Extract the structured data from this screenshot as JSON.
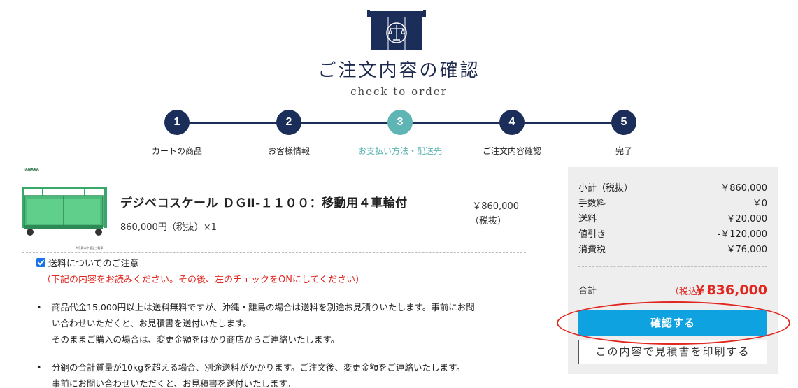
{
  "header": {
    "title": "ご注文内容の確認",
    "subtitle": "check to order"
  },
  "steps": [
    {
      "num": "1",
      "label": "カートの商品"
    },
    {
      "num": "2",
      "label": "お客様情報"
    },
    {
      "num": "3",
      "label": "お支払い方法・配送先"
    },
    {
      "num": "4",
      "label": "ご注文内容確認"
    },
    {
      "num": "5",
      "label": "完了"
    }
  ],
  "active_step": 3,
  "product": {
    "brand": "TANAKA",
    "name": "デジベコスケール ＤＧⅡ-１１００：移動用４車輪付",
    "unit_line": "860,000円（税抜）×1",
    "price": "￥860,000",
    "price_tax_note": "（税抜）",
    "image_caption": "※写真は中量型三輪車"
  },
  "notice": {
    "checkbox_label": "送料についてのご注意",
    "checked": true,
    "warning": "（下記の内容をお読みください。その後、左のチェックをONにしてください）",
    "bullets": [
      {
        "lines": [
          "商品代金15,000円以上は送料無料ですが、沖縄・離島の場合は送料を別途お見積りいたします。事前にお問",
          "い合わせいただくと、お見積書を送付いたします。",
          "そのままご購入の場合は、変更金額をはかり商店からご連絡いたします。"
        ]
      },
      {
        "lines": [
          "分銅の合計質量が10kgを超える場合、別途送料がかかります。ご注文後、変更金額をご連絡いたします。",
          "事前にお問い合わせいただくと、お見積書を送付いたします。"
        ]
      }
    ]
  },
  "summary": {
    "rows": [
      {
        "label": "小計（税抜）",
        "value": "￥860,000"
      },
      {
        "label": "手数料",
        "value": "￥0"
      },
      {
        "label": "送料",
        "value": "￥20,000"
      },
      {
        "label": "値引き",
        "value": "-￥120,000"
      },
      {
        "label": "消費税",
        "value": "￥76,000"
      }
    ],
    "total_label": "合計",
    "total_tax_note": "（税込）",
    "total_value": "￥836,000",
    "confirm_button": "確認する",
    "print_button": "この内容で見積書を印刷する"
  },
  "colors": {
    "navy": "#1b2e5a",
    "teal": "#5fb4b4",
    "red": "#e0261f",
    "button_blue": "#0ea2e0"
  }
}
